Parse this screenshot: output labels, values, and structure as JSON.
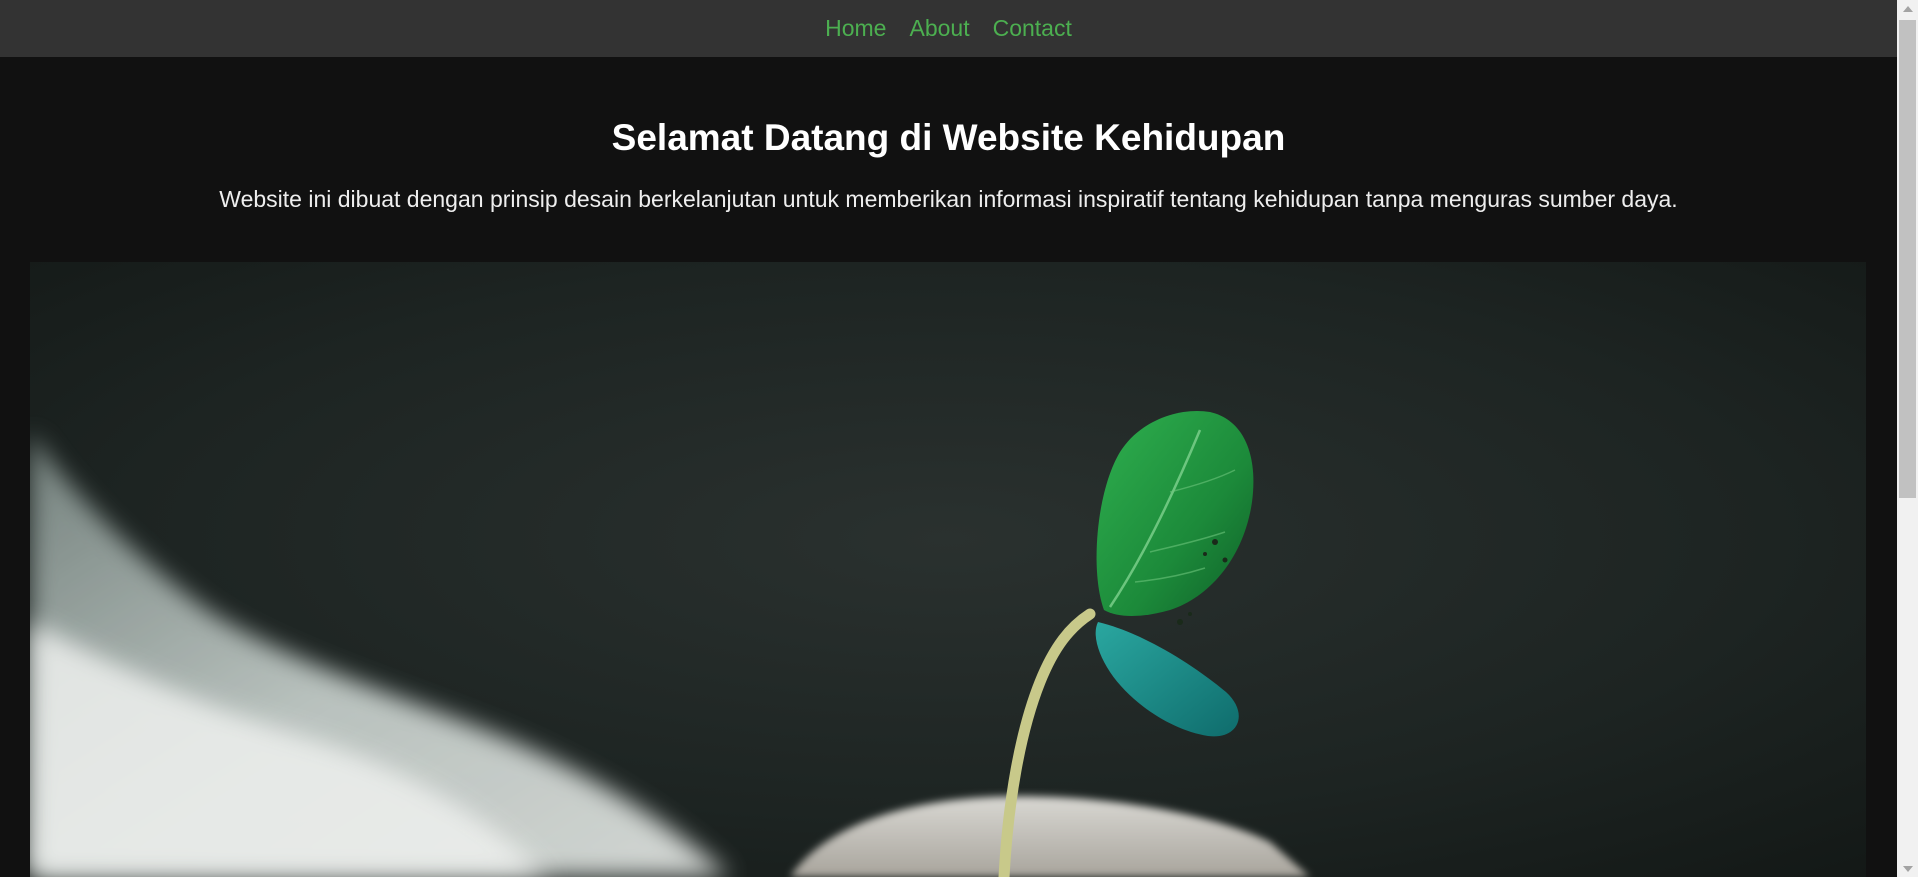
{
  "nav": {
    "items": [
      {
        "label": "Home"
      },
      {
        "label": "About"
      },
      {
        "label": "Contact"
      }
    ]
  },
  "hero": {
    "title": "Selamat Datang di Website Kehidupan",
    "description": "Website ini dibuat dengan prinsip desain berkelanjutan untuk memberikan informasi inspiratif tentang kehidupan tanpa menguras sumber daya."
  },
  "colors": {
    "nav_background": "#333333",
    "nav_link": "#4caf50",
    "page_background": "#111111",
    "heading": "#ffffff"
  },
  "image": {
    "subject": "seedling-sprout-in-hand"
  }
}
